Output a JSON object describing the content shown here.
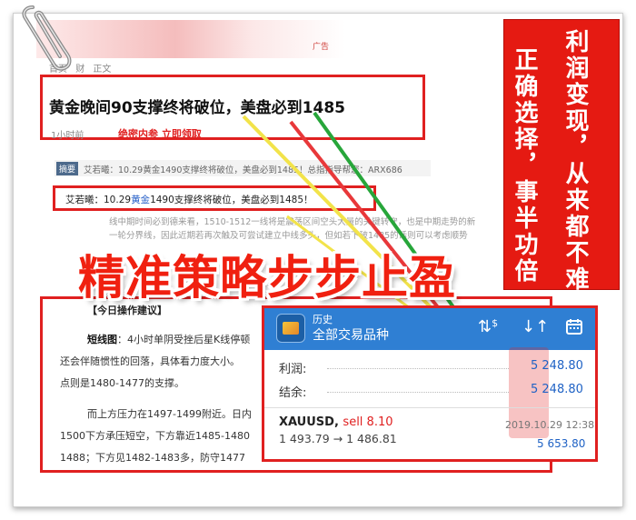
{
  "breadcrumb": [
    "首页",
    "财",
    "正文"
  ],
  "headline": "黄金晚间90支撑终将破位，美盘必到1485",
  "time_ago": "1小时前",
  "red_link": "绝密内参 立即领取",
  "summary": {
    "tag": "摘要",
    "text": "艾若曦：10.29黄金1490支撑终将破位，美盘必到1485！总指指导帮您：ARX686"
  },
  "quote": {
    "prefix": "艾若曦：10.29",
    "highlight": "黄金",
    "suffix": "1490支撑终将破位，美盘必到1485！"
  },
  "faded_lines": [
    "线中期时间必到德来看，1510-1512一线将是震荡区间空头大量的关键转守，也是中期走势的新",
    "一轮分界线，因此近期若再次触及可尝试建立中线多头，但如若下破1485的话则可以考虑顺势"
  ],
  "slogan": "精准策略步步止盈",
  "banner": {
    "col1": "利润变现，从来都不难",
    "col2": "正确选择，事半功倍"
  },
  "topstrip_tag": "广告",
  "article": {
    "advice_title": "【今日操作建议】",
    "lines": [
      {
        "bold": "短线图",
        "text": "：4小时单阴受挫后星K线停顿"
      },
      {
        "bold": "",
        "text": "还会伴随惯性的回落，具体看力度大小。"
      },
      {
        "bold": "",
        "text": "点则是1480-1477的支撑。"
      },
      {
        "bold": "",
        "text": "而上方压力在1497-1499附近。日内"
      },
      {
        "bold": "",
        "text": "1500下方承压短空，下方靠近1485-1480"
      },
      {
        "bold": "",
        "text": "1488；下方见1482-1483多，防守1477"
      }
    ]
  },
  "phone": {
    "title": "历史",
    "subtitle": "全部交易品种",
    "icons": [
      "currency-swap-icon",
      "sort-icon",
      "calendar-icon"
    ],
    "profit_label": "利润:",
    "profit_value": "5 248.80",
    "balance_label": "结余:",
    "balance_value": "5 248.80",
    "trade": {
      "symbol": "XAUUSD,",
      "side": "sell 8.10",
      "prices": "1 493.79 → 1 486.81",
      "date": "2019.10.29 12:38",
      "pnl": "5 653.80"
    }
  },
  "colors": {
    "accent_red": "#e02020",
    "banner_red": "#e51a12",
    "phone_blue": "#2f7fd3",
    "value_blue": "#1f62c5"
  }
}
